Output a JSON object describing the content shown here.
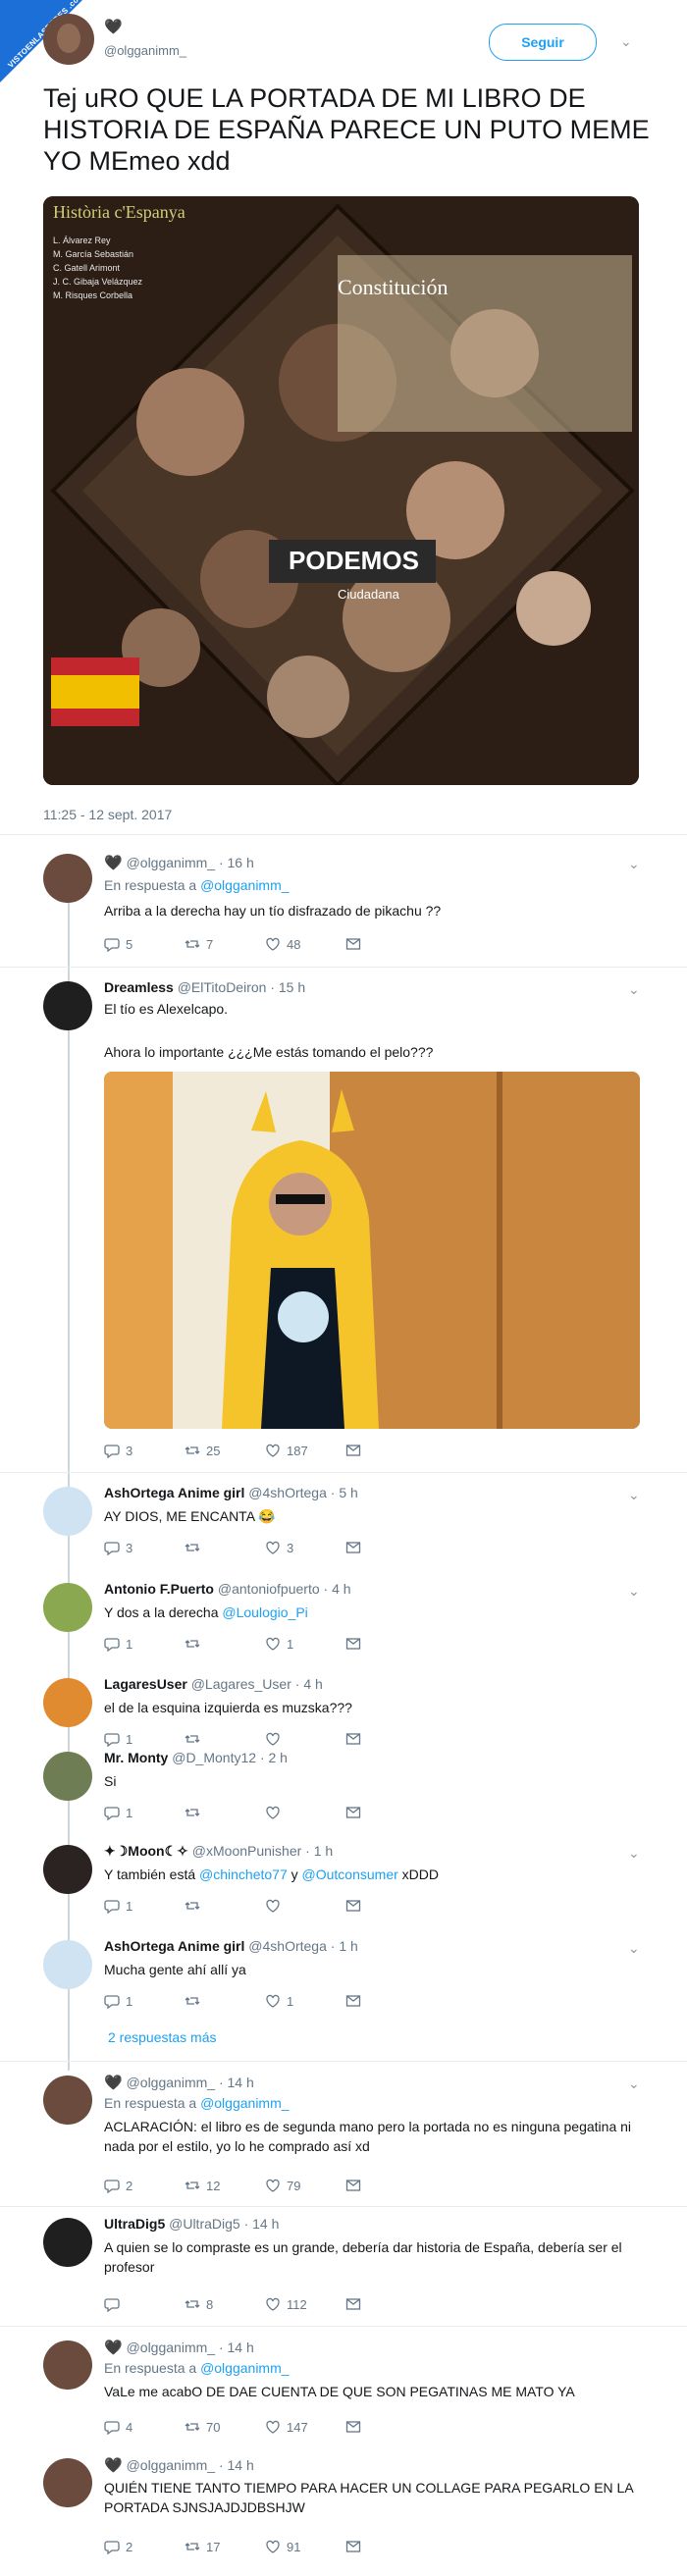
{
  "watermark": "VISTOENLASREDES .com",
  "header": {
    "heart": "🖤",
    "handle": "@olgganimm_",
    "follow_label": "Seguir"
  },
  "tweet": {
    "text": "Tej uRO QUE LA PORTADA DE MI LIBRO DE HISTORIA DE ESPAÑA PARECE UN PUTO MEME YO     MEmeo xdd",
    "image_text": {
      "title": "Història c'Espanya",
      "authors": [
        "L. Álvarez Rey",
        "M. García Sebastián",
        "C. Gatell Arimont",
        "J. C. Gibaja Velázquez",
        "M. Risques Corbella"
      ],
      "logo": "PODEMOS",
      "sub": "Ciudadana",
      "constitucion": "Constitución"
    },
    "timestamp": "11:25 - 12 sept. 2017"
  },
  "replies": [
    {
      "heart": "🖤",
      "name": "",
      "handle": "@olgganimm_",
      "time": "· 16 h",
      "in_reply_prefix": "En respuesta a",
      "in_reply_to": "@olgganimm_",
      "text": "Arriba a la derecha hay un tío disfrazado de pikachu  ??",
      "replies": "5",
      "retweets": "7",
      "likes": "48"
    },
    {
      "name": "Dreamless",
      "handle": "@ElTitoDeiron",
      "time": "· 15 h",
      "text1": "El tío es Alexelcapo.",
      "text2": "Ahora lo importante ¿¿¿Me estás tomando el pelo???",
      "replies": "3",
      "retweets": "25",
      "likes": "187"
    },
    {
      "name": "AshOrtega Anime girl",
      "handle": "@4shOrtega",
      "time": "· 5 h",
      "text": "AY DIOS, ME ENCANTA 😂",
      "replies": "3",
      "retweets": "",
      "likes": "3"
    },
    {
      "name": "Antonio F.Puerto",
      "handle": "@antoniofpuerto",
      "time": "· 4 h",
      "text": "Y dos a la derecha",
      "mention": "@Loulogio_Pi",
      "replies": "1",
      "retweets": "",
      "likes": "1"
    },
    {
      "name": "LagaresUser",
      "handle": "@Lagares_User",
      "time": "· 4 h",
      "text": "el de la esquina izquierda es muzska???",
      "replies": "1",
      "retweets": "",
      "likes": ""
    },
    {
      "name": "Mr. Monty",
      "handle": "@D_Monty12",
      "time": "· 2 h",
      "text": "Si",
      "replies": "1",
      "retweets": "",
      "likes": ""
    },
    {
      "name": "✦☽Moon☾✧",
      "handle": "@xMoonPunisher",
      "time": "· 1 h",
      "text": "Y también está",
      "mention1": "@chincheto77",
      "and": "y",
      "mention2": "@Outconsumer",
      "tail": "xDDD",
      "replies": "1",
      "retweets": "",
      "likes": ""
    },
    {
      "name": "AshOrtega Anime girl",
      "handle": "@4shOrtega",
      "time": "· 1 h",
      "text": "Mucha gente ahí allí ya",
      "replies": "1",
      "retweets": "",
      "likes": "1"
    },
    {
      "more": "2 respuestas más"
    },
    {
      "heart": "🖤",
      "handle": "@olgganimm_",
      "time": "· 14 h",
      "in_reply_prefix": "En respuesta a",
      "in_reply_to": "@olgganimm_",
      "text": "ACLARACIÓN: el libro es de segunda mano pero la portada no es ninguna pegatina ni nada por el estilo, yo lo he comprado así xd",
      "replies": "2",
      "retweets": "12",
      "likes": "79"
    },
    {
      "name": "UltraDig5",
      "handle": "@UltraDig5",
      "time": "· 14 h",
      "text": "A quien se lo compraste es un grande, debería dar historia de España, debería ser el profesor",
      "replies": "",
      "retweets": "8",
      "likes": "112"
    },
    {
      "heart": "🖤",
      "handle": "@olgganimm_",
      "time": "· 14 h",
      "in_reply_prefix": "En respuesta a",
      "in_reply_to": "@olgganimm_",
      "text": "VaLe me acabO DE DAE CUENTA DE QUE SON PEGATINAS ME MATO YA",
      "replies": "4",
      "retweets": "70",
      "likes": "147"
    },
    {
      "heart": "🖤",
      "handle": "@olgganimm_",
      "time": "· 14 h",
      "text": "QUIÉN TIENE TANTO TIEMPO PARA HACER UN COLLAGE PARA PEGARLO EN LA PORTADA SJNSJAJDJDBSHJW",
      "replies": "2",
      "retweets": "17",
      "likes": "91"
    }
  ],
  "colors": {
    "accent": "#1da1f2",
    "meta": "#657786",
    "divider": "#e6ecf0",
    "badge": "#1b6fd6"
  },
  "icons": [
    "reply-icon",
    "retweet-icon",
    "like-icon",
    "dm-icon",
    "chevron-down-icon"
  ]
}
